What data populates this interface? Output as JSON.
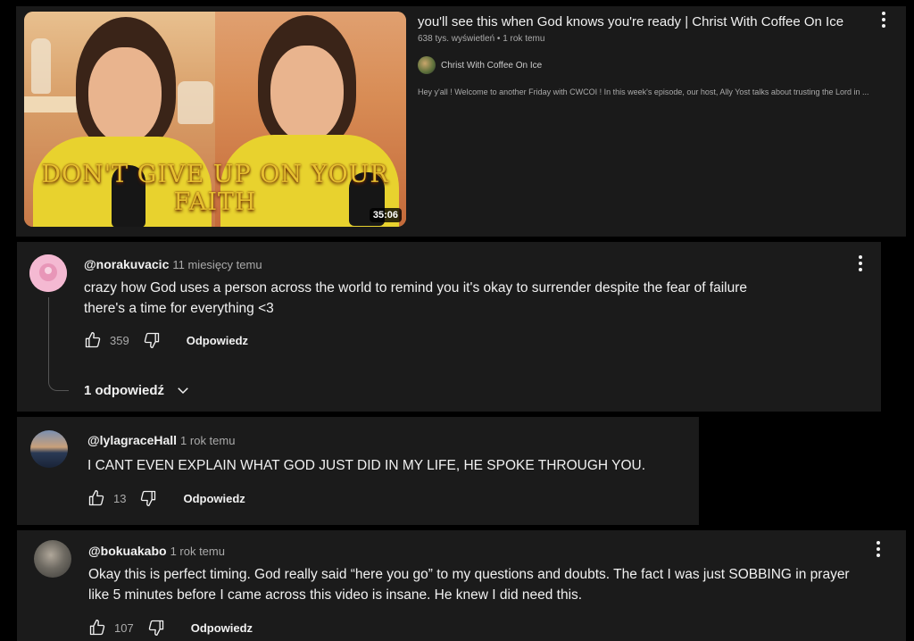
{
  "video": {
    "title": "you'll see this when God knows you're ready | Christ With Coffee On Ice",
    "meta": "638 tys. wyświetleń • 1 rok temu",
    "channel": "Christ With Coffee On Ice",
    "description": "Hey y'all ! Welcome to another Friday with CWCOI ! In this week's episode, our host, Ally Yost talks about trusting the Lord in ...",
    "thumbnail_text": "DON'T GIVE UP ON YOUR FAITH",
    "duration": "35:06"
  },
  "comments": [
    {
      "handle": "@norakuvacic",
      "time": "11 miesięcy temu",
      "lines": [
        "crazy how God uses a person across the world to remind you it's okay to surrender despite the fear of failure",
        "there's a time for everything <3"
      ],
      "likes": "359",
      "reply_label": "Odpowiedz",
      "replies_label": "1 odpowiedź"
    },
    {
      "handle": "@lylagraceHall",
      "time": "1 rok temu",
      "lines": [
        "I CANT EVEN EXPLAIN WHAT GOD JUST DID IN MY LIFE, HE SPOKE THROUGH YOU."
      ],
      "likes": "13",
      "reply_label": "Odpowiedz"
    },
    {
      "handle": "@bokuakabo",
      "time": "1 rok temu",
      "lines": [
        "Okay this is perfect timing. God really said “here you go” to my questions and doubts. The fact I was just SOBBING in prayer",
        "like 5 minutes before I came across this video is insane. He knew I did need this."
      ],
      "likes": "107",
      "reply_label": "Odpowiedz"
    }
  ],
  "icons": {
    "like": "thumbs-up-icon",
    "dislike": "thumbs-down-icon",
    "more": "more-vert-icon",
    "expand": "chevron-down-icon"
  },
  "colors": {
    "background": "#000000",
    "card": "#1b1b1b",
    "thumbnail_text": "#e6c030",
    "hoodie": "#e8d22e"
  }
}
